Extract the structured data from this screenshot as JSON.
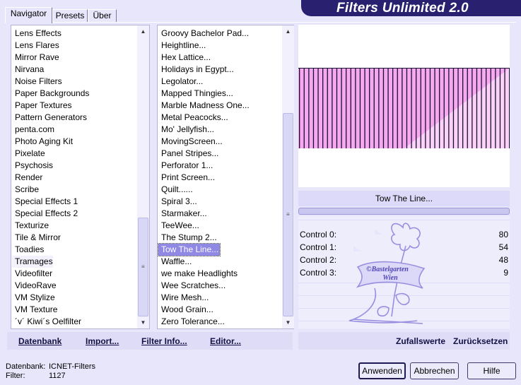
{
  "app": {
    "title": "Filters Unlimited 2.0"
  },
  "tabs": [
    {
      "label": "Navigator",
      "active": true
    },
    {
      "label": "Presets",
      "active": false
    },
    {
      "label": "Über",
      "active": false
    }
  ],
  "categories": [
    "Lens Effects",
    "Lens Flares",
    "Mirror Rave",
    "Nirvana",
    "Noise Filters",
    "Paper Backgrounds",
    "Paper Textures",
    "Pattern Generators",
    "penta.com",
    "Photo Aging Kit",
    "Pixelate",
    "Psychosis",
    "Render",
    "Scribe",
    "Special Effects 1",
    "Special Effects 2",
    "Texturize",
    "Tile & Mirror",
    "Toadies",
    "Tramages",
    "Videofilter",
    "VideoRave",
    "VM Stylize",
    "VM Texture",
    "´v´ Kiwi´s Oelfilter"
  ],
  "categories_selected": "Tramages",
  "filters": [
    "Groovy Bachelor Pad...",
    "Heightline...",
    "Hex Lattice...",
    "Holidays in Egypt...",
    "Legolator...",
    "Mapped Thingies...",
    "Marble Madness One...",
    "Metal Peacocks...",
    "Mo' Jellyfish...",
    "MovingScreen...",
    "Panel Stripes...",
    "Perforator 1...",
    "Print Screen...",
    "Quilt......",
    "Spiral 3...",
    "Starmaker...",
    "TeeWee...",
    "The Stump 2...",
    "Tow The Line...",
    "Waffle...",
    "we make Headlights",
    "Wee Scratches...",
    "Wire Mesh...",
    "Wood Grain...",
    "Zero Tolerance..."
  ],
  "filters_selected": "Tow The Line...",
  "filter_name": "Tow The Line...",
  "controls": [
    {
      "label": "Control 0:",
      "value": "80"
    },
    {
      "label": "Control 1:",
      "value": "54"
    },
    {
      "label": "Control 2:",
      "value": "48"
    },
    {
      "label": "Control 3:",
      "value": "9"
    }
  ],
  "watermark": {
    "line1": "©Bastelgarten",
    "line2": "Wien"
  },
  "toolbar": {
    "datenbank": "Datenbank",
    "import": "Import...",
    "filter_info": "Filter Info...",
    "editor": "Editor...",
    "zufallswerte": "Zufallswerte",
    "zuruecksetzen": "Zurücksetzen"
  },
  "status": {
    "db_label": "Datenbank:",
    "db_value": "ICNET-Filters",
    "filter_label": "Filter:",
    "filter_value": "1127"
  },
  "buttons": {
    "apply": "Anwenden",
    "cancel": "Abbrechen",
    "help": "Hilfe"
  },
  "colors": {
    "banner": "#2a2070",
    "selection": "#8f88e4",
    "preview_pink": "#f6a8f0",
    "preview_light_pink": "#fbd3f8",
    "preview_line": "#1a1030"
  },
  "icons": {
    "scroll_up": "▲",
    "scroll_down": "▼",
    "grip": "≡"
  }
}
